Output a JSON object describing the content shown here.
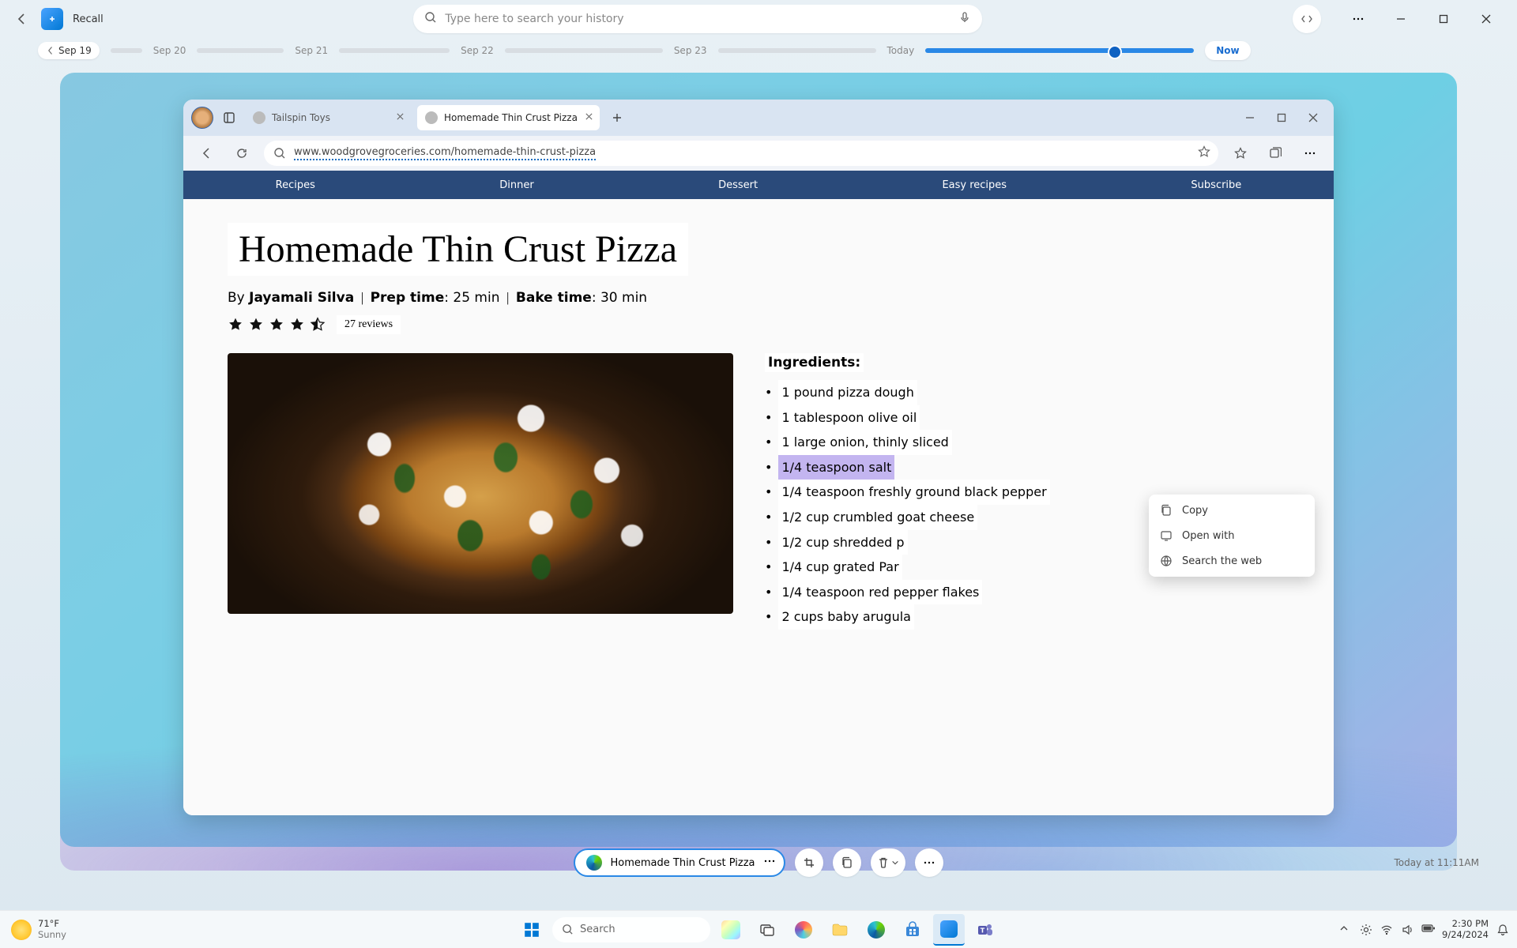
{
  "app": {
    "name": "Recall"
  },
  "search_placeholder": "Type here to search your history",
  "timeline": {
    "dates": [
      "Sep 19",
      "Sep 20",
      "Sep 21",
      "Sep 22",
      "Sep 23"
    ],
    "today_label": "Today",
    "now_label": "Now"
  },
  "browser": {
    "tabs": [
      {
        "title": "Tailspin Toys",
        "active": false
      },
      {
        "title": "Homemade Thin Crust Pizza",
        "active": true
      }
    ],
    "url": "www.woodgrovegroceries.com/homemade-thin-crust-pizza",
    "nav_links": [
      "Recipes",
      "Dinner",
      "Dessert",
      "Easy recipes",
      "Subscribe"
    ]
  },
  "recipe": {
    "title": "Homemade Thin Crust Pizza",
    "author_prefix": "By ",
    "author": "Jayamali Silva",
    "prep_label": "Prep time",
    "prep_value": ": 25 min",
    "bake_label": "Bake time",
    "bake_value": ": 30 min",
    "reviews": "27 reviews",
    "ingredients_heading": "Ingredients:",
    "ingredients": [
      "1 pound pizza dough",
      "1 tablespoon olive oil",
      "1 large onion, thinly sliced",
      "1/4 teaspoon salt",
      "1/4 teaspoon freshly ground black pepper",
      "1/2 cup crumbled goat cheese",
      "1/2 cup shredded p",
      "1/4 cup grated Par",
      "1/4 teaspoon red pepper flakes",
      "2 cups baby arugula"
    ],
    "selected_index": 3
  },
  "context_menu": {
    "items": [
      "Copy",
      "Open with",
      "Search the web"
    ]
  },
  "action": {
    "source_label": "Homemade Thin Crust Pizza",
    "timestamp": "Today at 11:11AM"
  },
  "taskbar": {
    "weather": {
      "temp": "71°F",
      "cond": "Sunny"
    },
    "search_placeholder": "Search",
    "clock": {
      "time": "2:30 PM",
      "date": "9/24/2024"
    }
  }
}
